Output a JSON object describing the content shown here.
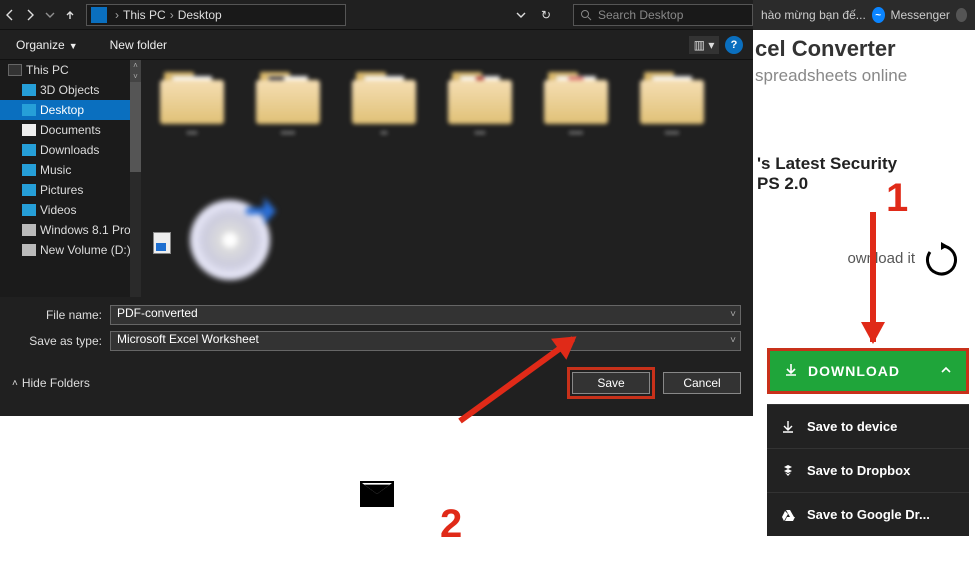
{
  "dialog": {
    "breadcrumb": {
      "root": "This PC",
      "current": "Desktop"
    },
    "search_placeholder": "Search Desktop",
    "toolbar": {
      "organize": "Organize",
      "newfolder": "New folder"
    },
    "sidebar": {
      "root": "This PC",
      "items": [
        "3D Objects",
        "Desktop",
        "Documents",
        "Downloads",
        "Music",
        "Pictures",
        "Videos",
        "Windows 8.1 Pro",
        "New Volume (D:)"
      ],
      "selected_index": 1
    },
    "filename_label": "File name:",
    "filename_value": "PDF-converted",
    "savetype_label": "Save as type:",
    "savetype_value": "Microsoft Excel Worksheet",
    "hide_folders": "Hide Folders",
    "save": "Save",
    "cancel": "Cancel"
  },
  "browser": {
    "tab1": "hào mừng bạn đế...",
    "tab2": "Messenger",
    "title_fragment": "cel Converter",
    "subtitle_fragment": "spreadsheets online",
    "sec_line1": "'s Latest Security",
    "sec_line2": "PS 2.0",
    "download_it": "ownload it",
    "download_btn": "DOWNLOAD",
    "menu": [
      "Save to device",
      "Save to Dropbox",
      "Save to Google Dr..."
    ]
  },
  "annotations": {
    "n1": "1",
    "n2": "2"
  }
}
